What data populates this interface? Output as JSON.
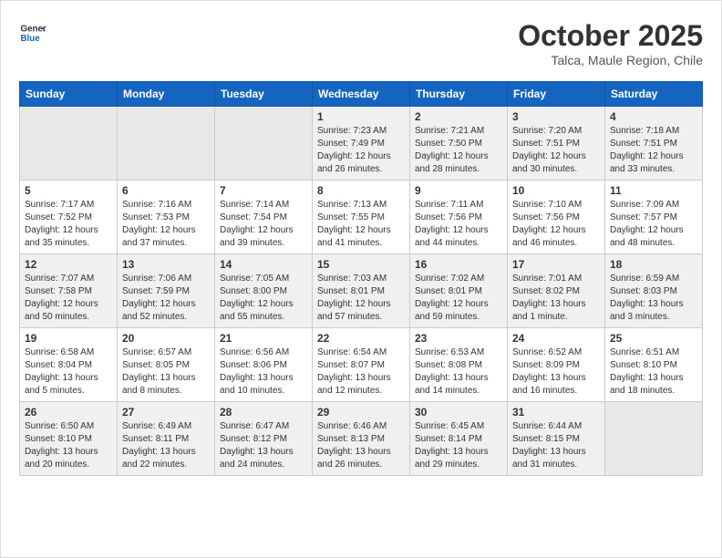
{
  "logo": {
    "text_general": "General",
    "text_blue": "Blue"
  },
  "header": {
    "month_title": "October 2025",
    "subtitle": "Talca, Maule Region, Chile"
  },
  "weekdays": [
    "Sunday",
    "Monday",
    "Tuesday",
    "Wednesday",
    "Thursday",
    "Friday",
    "Saturday"
  ],
  "weeks": [
    [
      {
        "day": "",
        "info": ""
      },
      {
        "day": "",
        "info": ""
      },
      {
        "day": "",
        "info": ""
      },
      {
        "day": "1",
        "info": "Sunrise: 7:23 AM\nSunset: 7:49 PM\nDaylight: 12 hours\nand 26 minutes."
      },
      {
        "day": "2",
        "info": "Sunrise: 7:21 AM\nSunset: 7:50 PM\nDaylight: 12 hours\nand 28 minutes."
      },
      {
        "day": "3",
        "info": "Sunrise: 7:20 AM\nSunset: 7:51 PM\nDaylight: 12 hours\nand 30 minutes."
      },
      {
        "day": "4",
        "info": "Sunrise: 7:18 AM\nSunset: 7:51 PM\nDaylight: 12 hours\nand 33 minutes."
      }
    ],
    [
      {
        "day": "5",
        "info": "Sunrise: 7:17 AM\nSunset: 7:52 PM\nDaylight: 12 hours\nand 35 minutes."
      },
      {
        "day": "6",
        "info": "Sunrise: 7:16 AM\nSunset: 7:53 PM\nDaylight: 12 hours\nand 37 minutes."
      },
      {
        "day": "7",
        "info": "Sunrise: 7:14 AM\nSunset: 7:54 PM\nDaylight: 12 hours\nand 39 minutes."
      },
      {
        "day": "8",
        "info": "Sunrise: 7:13 AM\nSunset: 7:55 PM\nDaylight: 12 hours\nand 41 minutes."
      },
      {
        "day": "9",
        "info": "Sunrise: 7:11 AM\nSunset: 7:56 PM\nDaylight: 12 hours\nand 44 minutes."
      },
      {
        "day": "10",
        "info": "Sunrise: 7:10 AM\nSunset: 7:56 PM\nDaylight: 12 hours\nand 46 minutes."
      },
      {
        "day": "11",
        "info": "Sunrise: 7:09 AM\nSunset: 7:57 PM\nDaylight: 12 hours\nand 48 minutes."
      }
    ],
    [
      {
        "day": "12",
        "info": "Sunrise: 7:07 AM\nSunset: 7:58 PM\nDaylight: 12 hours\nand 50 minutes."
      },
      {
        "day": "13",
        "info": "Sunrise: 7:06 AM\nSunset: 7:59 PM\nDaylight: 12 hours\nand 52 minutes."
      },
      {
        "day": "14",
        "info": "Sunrise: 7:05 AM\nSunset: 8:00 PM\nDaylight: 12 hours\nand 55 minutes."
      },
      {
        "day": "15",
        "info": "Sunrise: 7:03 AM\nSunset: 8:01 PM\nDaylight: 12 hours\nand 57 minutes."
      },
      {
        "day": "16",
        "info": "Sunrise: 7:02 AM\nSunset: 8:01 PM\nDaylight: 12 hours\nand 59 minutes."
      },
      {
        "day": "17",
        "info": "Sunrise: 7:01 AM\nSunset: 8:02 PM\nDaylight: 13 hours\nand 1 minute."
      },
      {
        "day": "18",
        "info": "Sunrise: 6:59 AM\nSunset: 8:03 PM\nDaylight: 13 hours\nand 3 minutes."
      }
    ],
    [
      {
        "day": "19",
        "info": "Sunrise: 6:58 AM\nSunset: 8:04 PM\nDaylight: 13 hours\nand 5 minutes."
      },
      {
        "day": "20",
        "info": "Sunrise: 6:57 AM\nSunset: 8:05 PM\nDaylight: 13 hours\nand 8 minutes."
      },
      {
        "day": "21",
        "info": "Sunrise: 6:56 AM\nSunset: 8:06 PM\nDaylight: 13 hours\nand 10 minutes."
      },
      {
        "day": "22",
        "info": "Sunrise: 6:54 AM\nSunset: 8:07 PM\nDaylight: 13 hours\nand 12 minutes."
      },
      {
        "day": "23",
        "info": "Sunrise: 6:53 AM\nSunset: 8:08 PM\nDaylight: 13 hours\nand 14 minutes."
      },
      {
        "day": "24",
        "info": "Sunrise: 6:52 AM\nSunset: 8:09 PM\nDaylight: 13 hours\nand 16 minutes."
      },
      {
        "day": "25",
        "info": "Sunrise: 6:51 AM\nSunset: 8:10 PM\nDaylight: 13 hours\nand 18 minutes."
      }
    ],
    [
      {
        "day": "26",
        "info": "Sunrise: 6:50 AM\nSunset: 8:10 PM\nDaylight: 13 hours\nand 20 minutes."
      },
      {
        "day": "27",
        "info": "Sunrise: 6:49 AM\nSunset: 8:11 PM\nDaylight: 13 hours\nand 22 minutes."
      },
      {
        "day": "28",
        "info": "Sunrise: 6:47 AM\nSunset: 8:12 PM\nDaylight: 13 hours\nand 24 minutes."
      },
      {
        "day": "29",
        "info": "Sunrise: 6:46 AM\nSunset: 8:13 PM\nDaylight: 13 hours\nand 26 minutes."
      },
      {
        "day": "30",
        "info": "Sunrise: 6:45 AM\nSunset: 8:14 PM\nDaylight: 13 hours\nand 29 minutes."
      },
      {
        "day": "31",
        "info": "Sunrise: 6:44 AM\nSunset: 8:15 PM\nDaylight: 13 hours\nand 31 minutes."
      },
      {
        "day": "",
        "info": ""
      }
    ]
  ],
  "shaded_rows": [
    0,
    2,
    4
  ]
}
